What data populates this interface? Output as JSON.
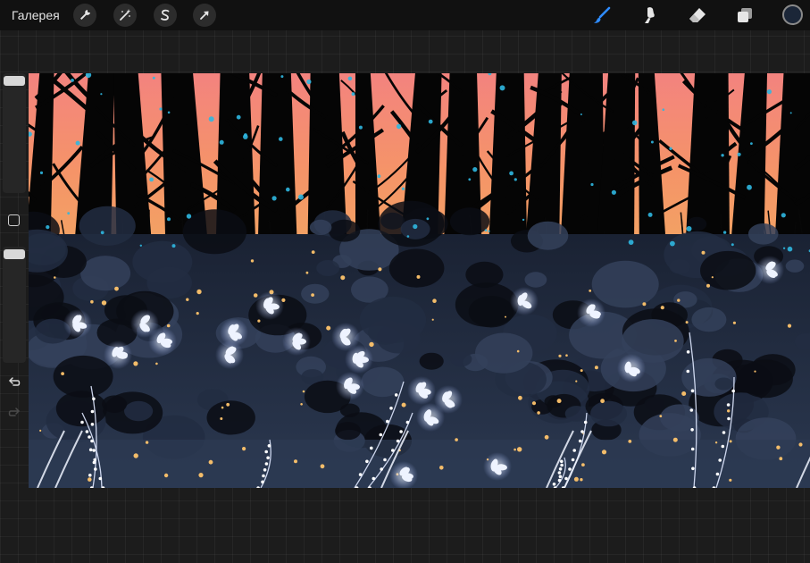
{
  "topbar": {
    "gallery_label": "Галерея",
    "left_tools": [
      {
        "name": "actions",
        "icon": "wrench-icon"
      },
      {
        "name": "adjustments",
        "icon": "magic-wand-icon"
      },
      {
        "name": "selection",
        "icon": "selection-s-icon"
      },
      {
        "name": "transform",
        "icon": "arrow-cursor-icon"
      }
    ],
    "right_tools": [
      {
        "name": "brush",
        "icon": "brush-icon",
        "active": true
      },
      {
        "name": "smudge",
        "icon": "smudge-icon"
      },
      {
        "name": "eraser",
        "icon": "eraser-icon"
      },
      {
        "name": "layers",
        "icon": "layers-icon"
      }
    ],
    "current_color": "#1b2638",
    "active_tool_color": "#2f8cff"
  },
  "sidebar": {
    "brush_size_slider": {
      "icon": "slider-thumb"
    },
    "modify_button": {
      "icon": "square-icon"
    },
    "opacity_slider": {
      "icon": "slider-thumb"
    },
    "undo": {
      "icon": "undo-icon"
    },
    "redo": {
      "icon": "redo-icon"
    }
  },
  "canvas": {
    "sky_top_color": "#f58a82",
    "sky_bottom_color": "#f5a062",
    "ground_color": "#1f2a3e"
  }
}
